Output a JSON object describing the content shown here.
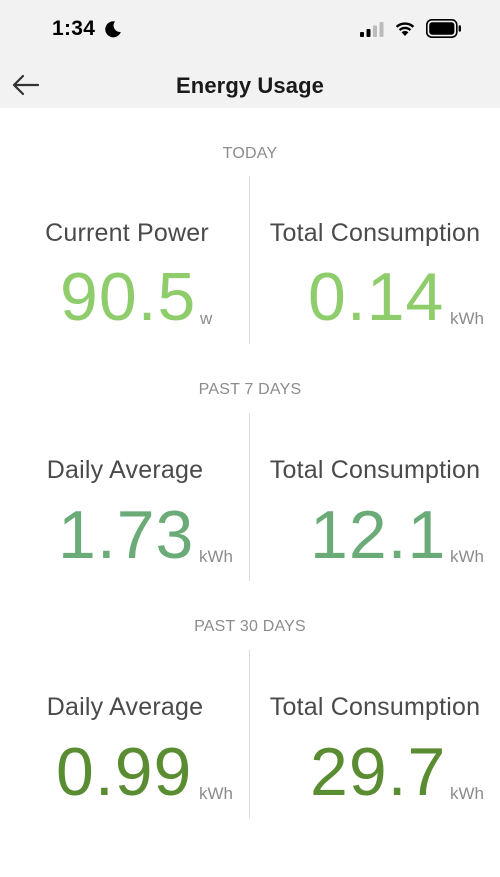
{
  "status_bar": {
    "time": "1:34"
  },
  "header": {
    "title": "Energy Usage"
  },
  "sections": [
    {
      "label": "TODAY",
      "left": {
        "label": "Current Power",
        "value": "90.5",
        "unit": "w"
      },
      "right": {
        "label": "Total Consumption",
        "value": "0.14",
        "unit": "kWh"
      },
      "color": "#8fcc6b"
    },
    {
      "label": "PAST 7 DAYS",
      "left": {
        "label": "Daily Average",
        "value": "1.73",
        "unit": "kWh"
      },
      "right": {
        "label": "Total Consumption",
        "value": "12.1",
        "unit": "kWh"
      },
      "color": "#6aab78"
    },
    {
      "label": "PAST 30 DAYS",
      "left": {
        "label": "Daily Average",
        "value": "0.99",
        "unit": "kWh"
      },
      "right": {
        "label": "Total Consumption",
        "value": "29.7",
        "unit": "kWh"
      },
      "color": "#5a8c32"
    }
  ]
}
